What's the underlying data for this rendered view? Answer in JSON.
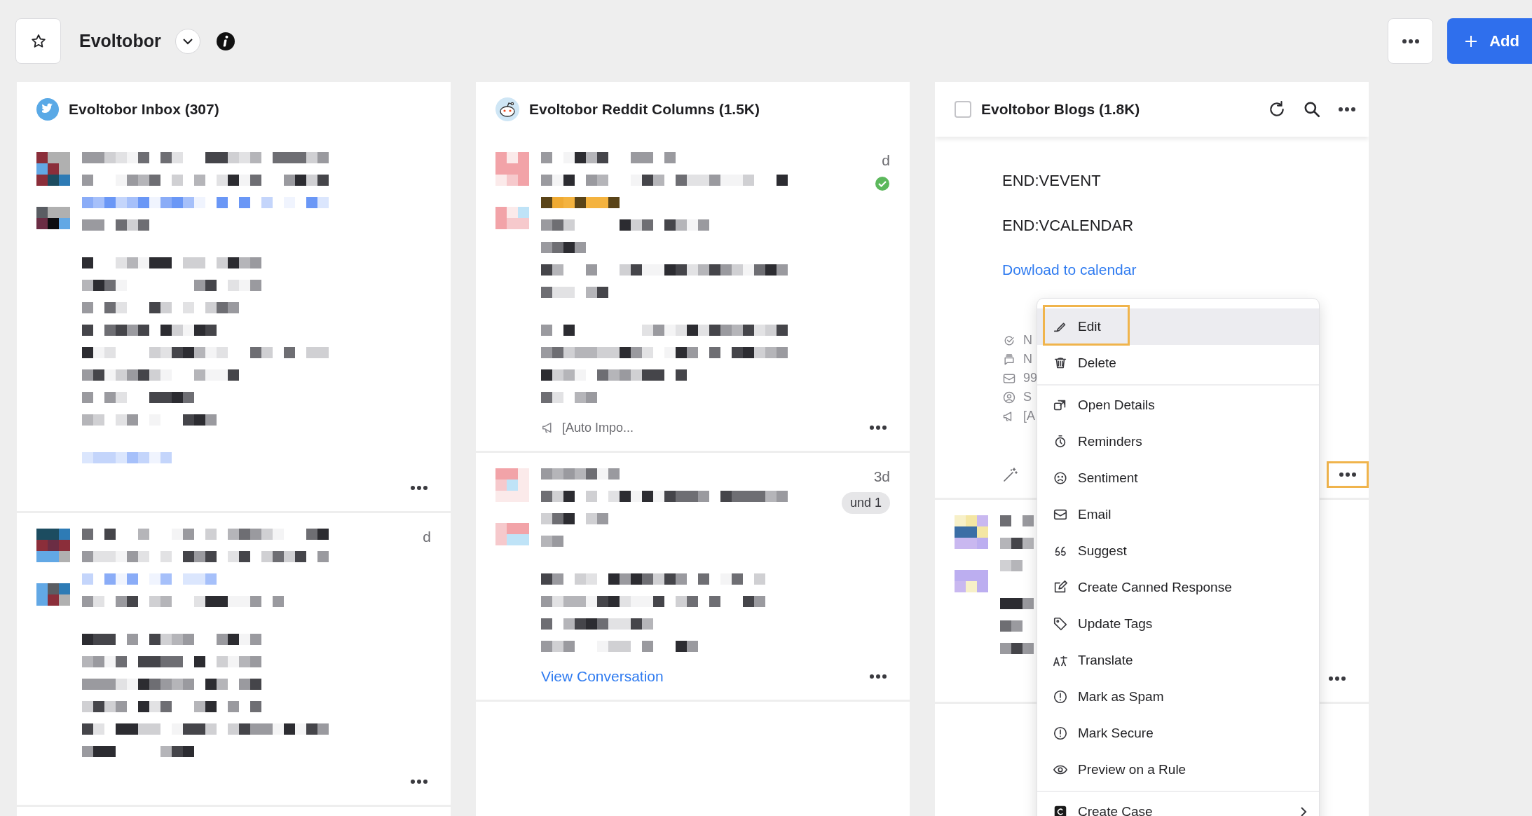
{
  "header": {
    "title": "Evoltobor",
    "add_label": "Add"
  },
  "columns": [
    {
      "kind": "twitter",
      "title": "Evoltobor Inbox (307)",
      "posts": [
        {
          "kind": "mosaic",
          "verified": false,
          "more_highlighted": false
        },
        {
          "kind": "mosaic",
          "time": "d",
          "verified": false,
          "more_highlighted": false
        }
      ]
    },
    {
      "kind": "reddit",
      "title": "Evoltobor Reddit Columns (1.5K)",
      "posts": [
        {
          "kind": "mosaic",
          "time": "d",
          "verified": true,
          "footer": "[Auto Impo...",
          "more_highlighted": false
        },
        {
          "kind": "mosaic",
          "time": "3d",
          "badge": "und 1",
          "link": "View Conversation",
          "verified": false,
          "more_highlighted": false
        }
      ]
    },
    {
      "kind": "blog",
      "title": "Evoltobor Blogs (1.8K)",
      "checked": false,
      "posts": [
        {
          "kind": "event",
          "lines": [
            "END:VEVENT",
            "END:VCALENDAR"
          ],
          "link": "Dowload to calendar",
          "verified": false,
          "more_highlighted": true,
          "meta": [
            {
              "kind": "status",
              "text": "N"
            },
            {
              "kind": "comments",
              "text": "N"
            },
            {
              "kind": "email",
              "text": "99"
            },
            {
              "kind": "user",
              "text": "S"
            },
            {
              "kind": "source",
              "text": "[A"
            }
          ]
        },
        {
          "kind": "mosaic",
          "verified": false,
          "more_highlighted": false
        }
      ]
    }
  ],
  "context_menu": {
    "groups": [
      {
        "items": [
          {
            "kind": "edit",
            "label": "Edit",
            "selected": true,
            "highlighted": true,
            "submenu": false
          },
          {
            "kind": "delete",
            "label": "Delete",
            "selected": false,
            "highlighted": false,
            "submenu": false
          }
        ]
      },
      {
        "items": [
          {
            "kind": "open",
            "label": "Open Details",
            "selected": false,
            "highlighted": false,
            "submenu": false
          },
          {
            "kind": "reminder",
            "label": "Reminders",
            "selected": false,
            "highlighted": false,
            "submenu": false
          },
          {
            "kind": "sentiment",
            "label": "Sentiment",
            "selected": false,
            "highlighted": false,
            "submenu": false
          },
          {
            "kind": "email",
            "label": "Email",
            "selected": false,
            "highlighted": false,
            "submenu": false
          },
          {
            "kind": "suggest",
            "label": "Suggest",
            "selected": false,
            "highlighted": false,
            "submenu": false
          },
          {
            "kind": "canned",
            "label": "Create Canned Response",
            "selected": false,
            "highlighted": false,
            "submenu": false
          },
          {
            "kind": "tags",
            "label": "Update Tags",
            "selected": false,
            "highlighted": false,
            "submenu": false
          },
          {
            "kind": "translate",
            "label": "Translate",
            "selected": false,
            "highlighted": false,
            "submenu": false
          },
          {
            "kind": "spam",
            "label": "Mark as Spam",
            "selected": false,
            "highlighted": false,
            "submenu": false
          },
          {
            "kind": "secure",
            "label": "Mark Secure",
            "selected": false,
            "highlighted": false,
            "submenu": false
          },
          {
            "kind": "preview",
            "label": "Preview on a Rule",
            "selected": false,
            "highlighted": false,
            "submenu": false
          }
        ]
      },
      {
        "items": [
          {
            "kind": "case",
            "label": "Create Case",
            "selected": false,
            "highlighted": false,
            "submenu": true
          }
        ]
      }
    ]
  }
}
